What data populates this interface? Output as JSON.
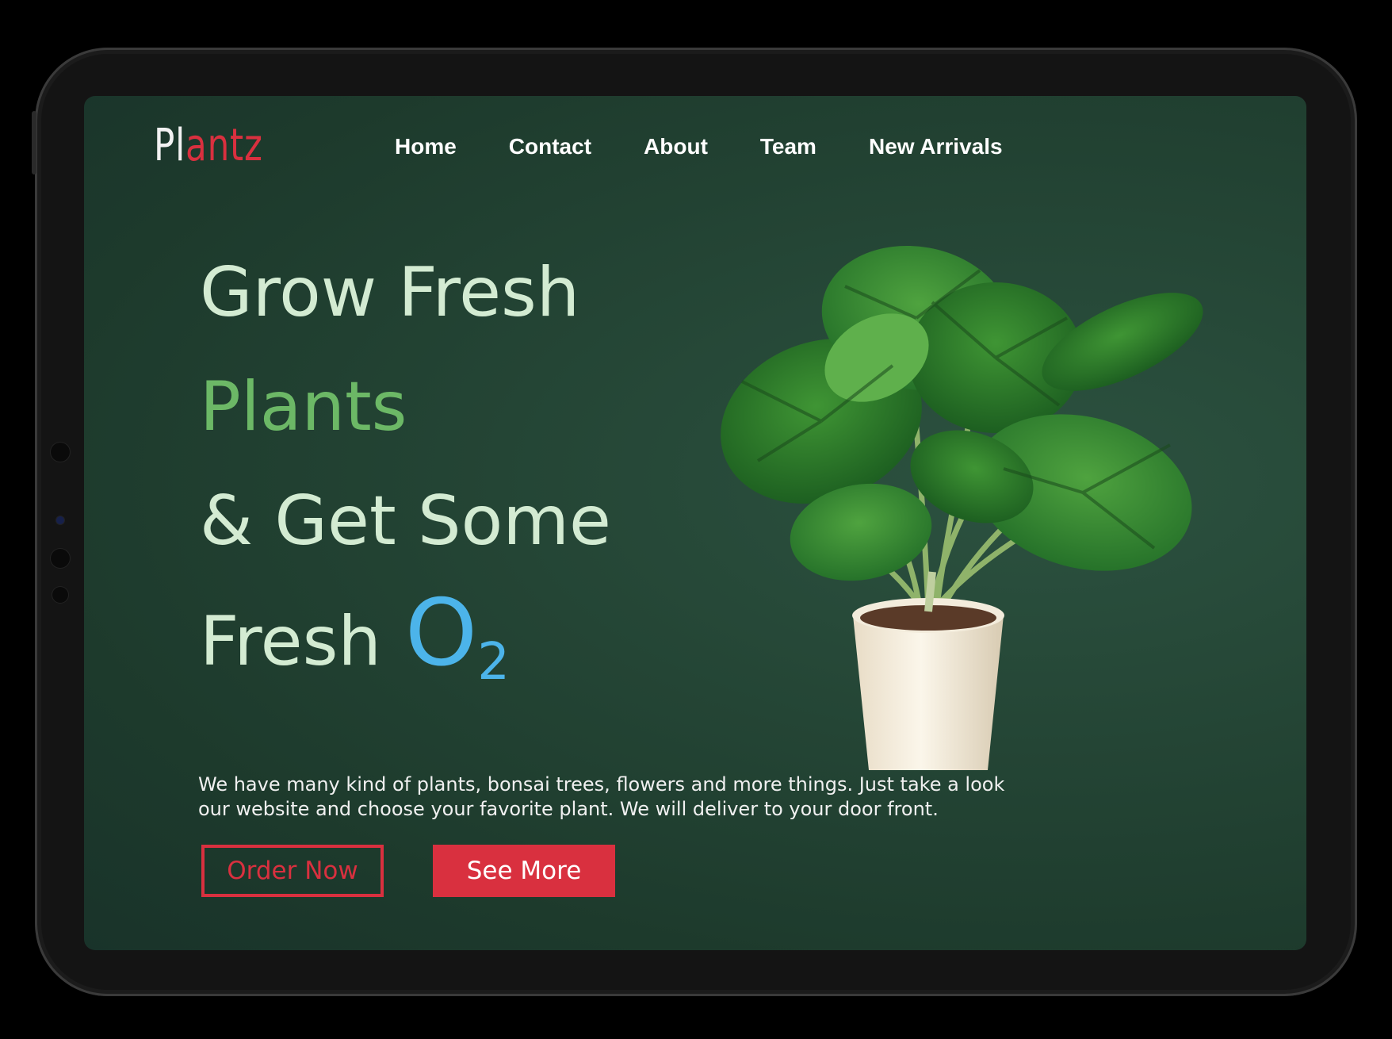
{
  "logo": {
    "part1": "Pl",
    "part2": "antz"
  },
  "nav": {
    "home": "Home",
    "contact": "Contact",
    "about": "About",
    "team": "Team",
    "new_arrivals": "New Arrivals"
  },
  "hero": {
    "line1": "Grow Fresh",
    "line2": "Plants",
    "line3": "& Get Some",
    "line4": "Fresh",
    "o2_main": "O",
    "o2_sub": "2"
  },
  "description": "We have many kind of plants, bonsai trees, flowers and more things. Just take a look our website and choose your favorite plant. We will deliver to your door front.",
  "buttons": {
    "order_now": "Order Now",
    "see_more": "See More"
  },
  "colors": {
    "accent": "#d9303f",
    "heading": "#d3ebd2",
    "heading_green": "#6cb866",
    "o2": "#4cb4ea",
    "background": "#1d3a2c"
  }
}
